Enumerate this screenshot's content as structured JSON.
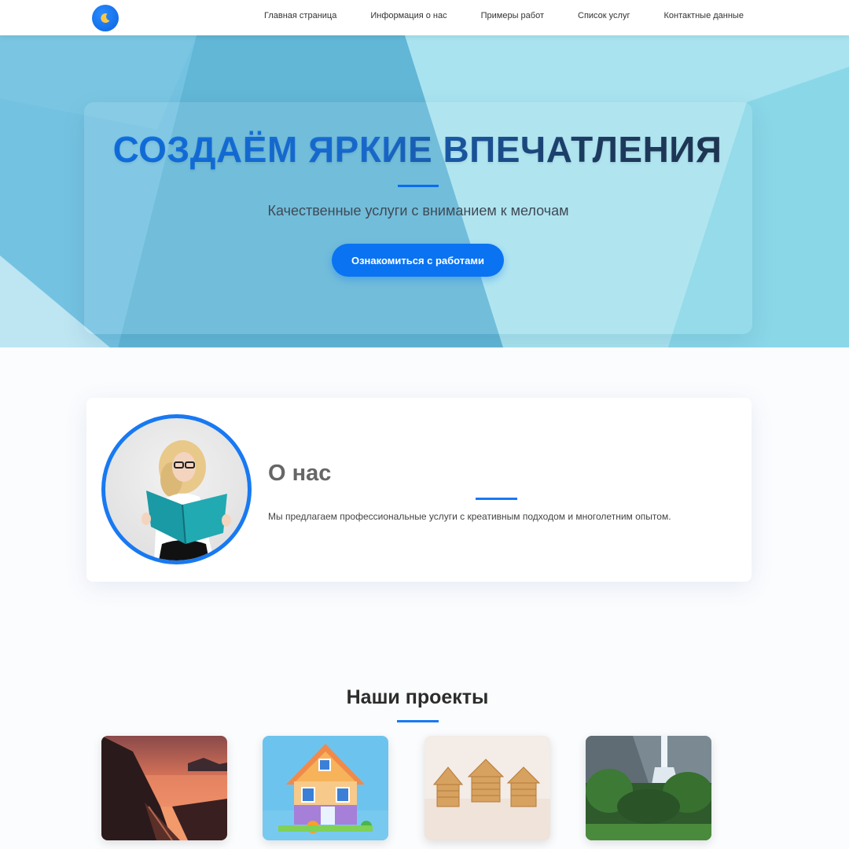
{
  "nav": {
    "logo_icon": "moon-icon",
    "links": [
      {
        "label": "Главная страница"
      },
      {
        "label": "Информация о нас"
      },
      {
        "label": "Примеры работ"
      },
      {
        "label": "Список услуг"
      },
      {
        "label": "Контактные данные"
      }
    ]
  },
  "hero": {
    "title": "СОЗДАЁМ ЯРКИЕ ВПЕЧАТЛЕНИЯ",
    "subtitle": "Качественные услуги с вниманием к мелочам",
    "button_label": "Ознакомиться с работами"
  },
  "about": {
    "title": "О нас",
    "text": "Мы предлагаем профессиональные услуги с креативным подходом и многолетним опытом.",
    "image": "woman-with-folder-photo"
  },
  "projects": {
    "title": "Наши проекты",
    "items": [
      {
        "image": "sunset-coast-stairs-photo"
      },
      {
        "image": "toy-house-render"
      },
      {
        "image": "wooden-houses-photo"
      },
      {
        "image": "waterfall-forest-photo"
      }
    ]
  },
  "colors": {
    "accent": "#0a73f2",
    "hero_bg": "#8fd6e8",
    "accent_line": "#1879f2"
  }
}
